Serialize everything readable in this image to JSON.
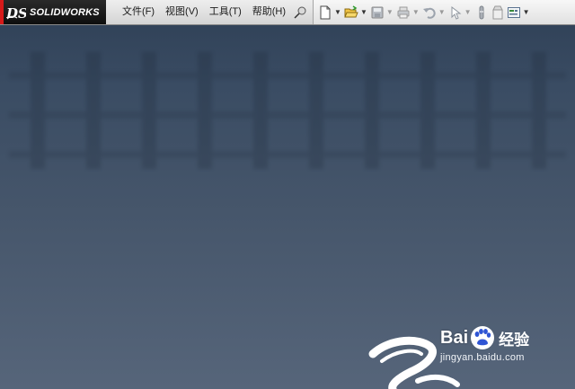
{
  "app": {
    "brand": "SOLIDWORKS",
    "brand_mark": "DS"
  },
  "menu": {
    "items": [
      {
        "label": "文件(F)"
      },
      {
        "label": "视图(V)"
      },
      {
        "label": "工具(T)"
      },
      {
        "label": "帮助(H)"
      }
    ]
  },
  "toolbar": {
    "buttons": [
      "pin-icon",
      "new-document-icon",
      "open-folder-icon",
      "save-icon",
      "print-icon",
      "undo-icon",
      "select-cursor-icon",
      "rebuild-icon",
      "file-properties-icon",
      "options-icon"
    ]
  },
  "watermark": {
    "brand_left": "Bai",
    "brand_right": "经验",
    "url": "jingyan.baidu.com"
  },
  "colors": {
    "accent_red": "#d61a1a",
    "background_top": "#2e3f55",
    "background_bottom": "#56657a"
  }
}
